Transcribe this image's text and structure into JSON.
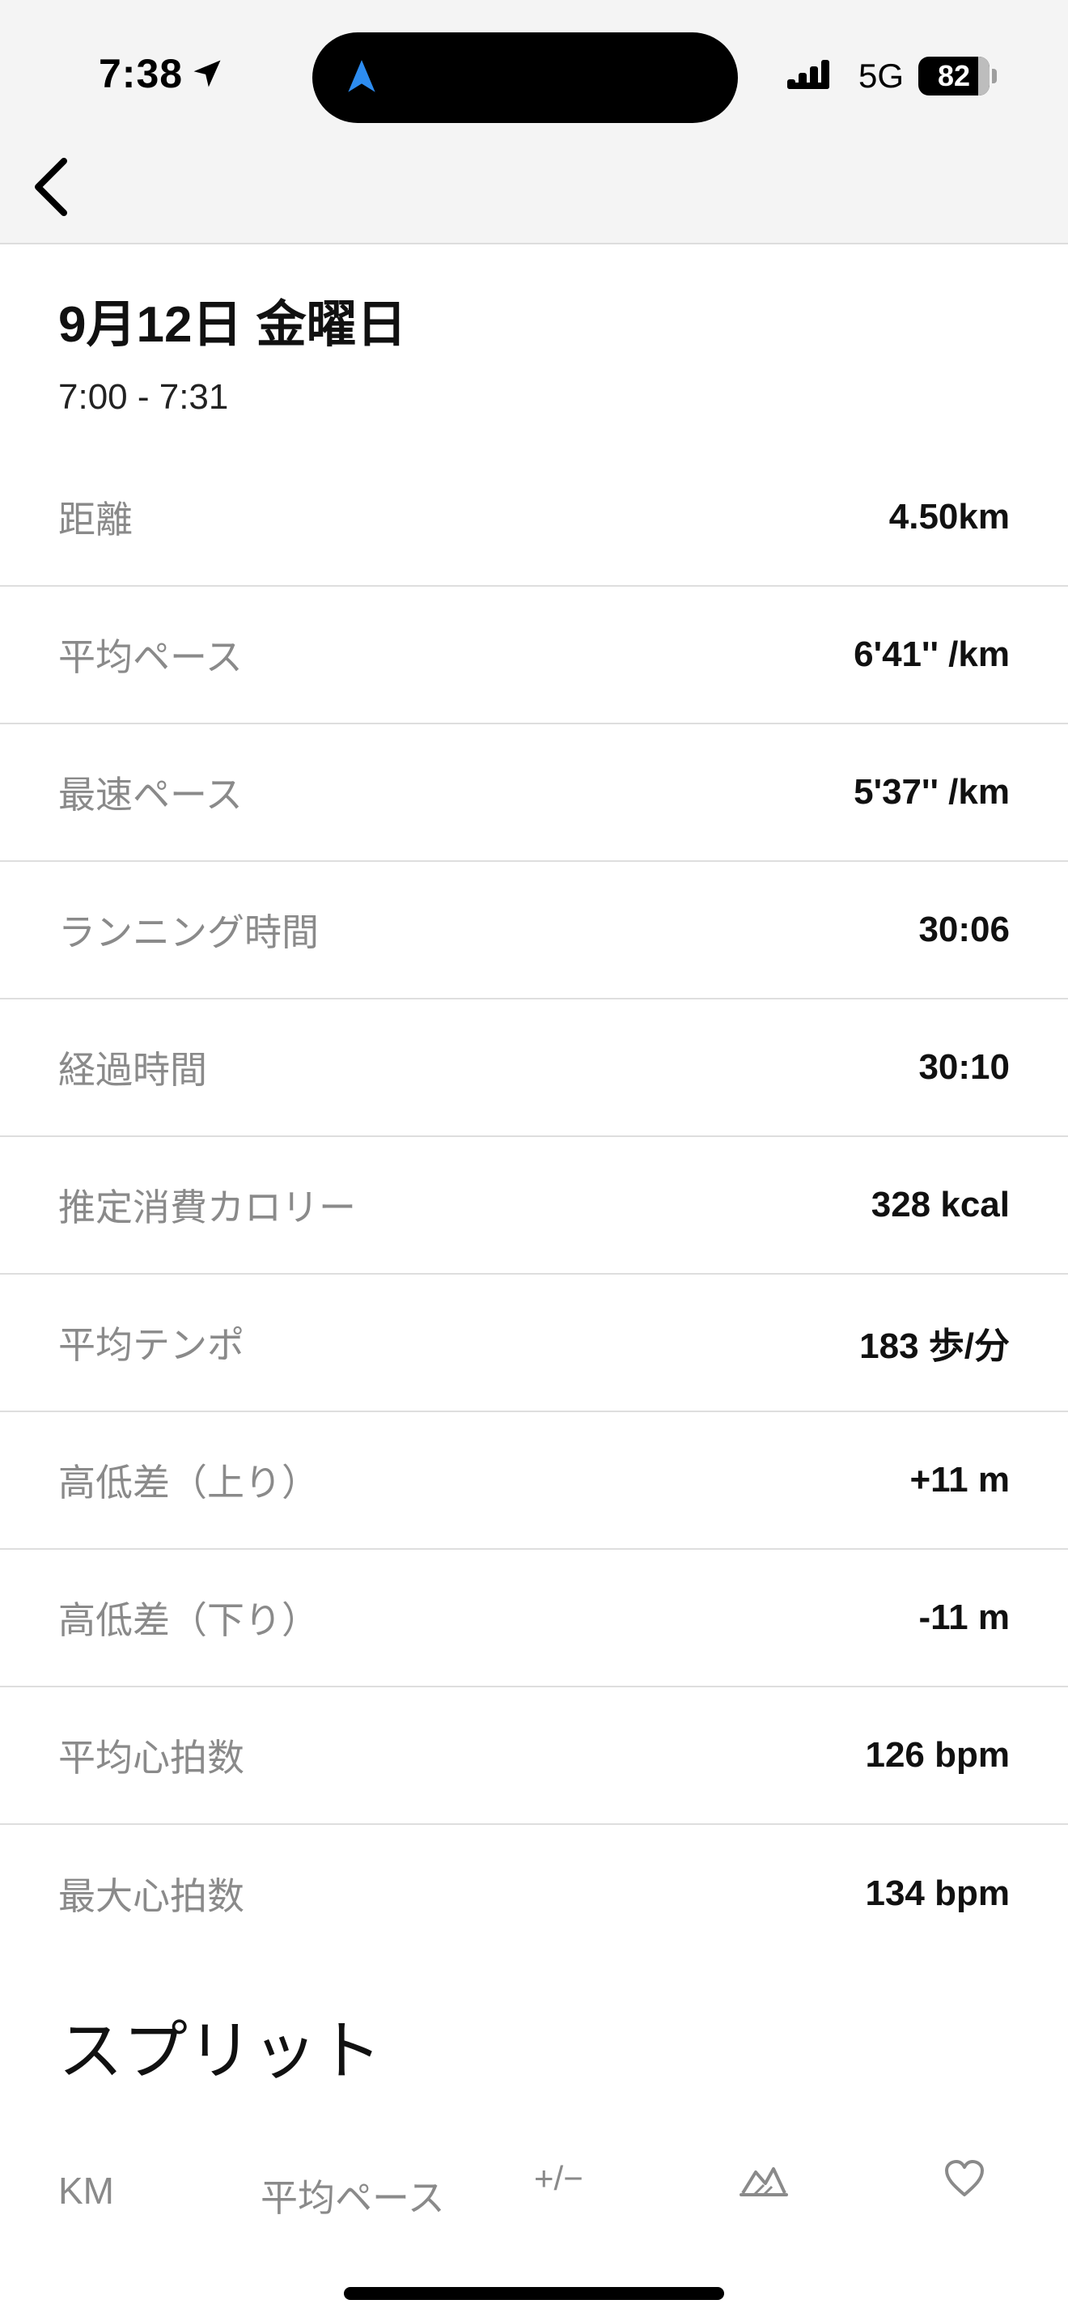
{
  "status_bar": {
    "time": "7:38",
    "network": "5G",
    "battery": "82"
  },
  "header": {
    "date": "9月12日 金曜日",
    "time_range": "7:00 - 7:31"
  },
  "stats": [
    {
      "label": "距離",
      "value": "4.50km"
    },
    {
      "label": "平均ペース",
      "value": "6'41'' /km"
    },
    {
      "label": "最速ペース",
      "value": "5'37'' /km"
    },
    {
      "label": "ランニング時間",
      "value": "30:06"
    },
    {
      "label": "経過時間",
      "value": "30:10"
    },
    {
      "label": "推定消費カロリー",
      "value": "328 kcal"
    },
    {
      "label": "平均テンポ",
      "value": "183 歩/分"
    },
    {
      "label": "高低差（上り）",
      "value": "+11 m"
    },
    {
      "label": "高低差（下り）",
      "value": "-11 m"
    },
    {
      "label": "平均心拍数",
      "value": "126 bpm"
    },
    {
      "label": "最大心拍数",
      "value": "134 bpm"
    }
  ],
  "splits": {
    "title": "スプリット",
    "columns": {
      "km": "KM",
      "pace": "平均ペース",
      "diff": "+/−"
    },
    "icons": {
      "elevation": "elevation-icon",
      "heart": "heart-icon"
    }
  },
  "colors": {
    "label_gray": "#8a8a8a",
    "divider": "#dedede",
    "top_bg": "#f4f4f4",
    "accent_blue": "#1e88e5"
  }
}
